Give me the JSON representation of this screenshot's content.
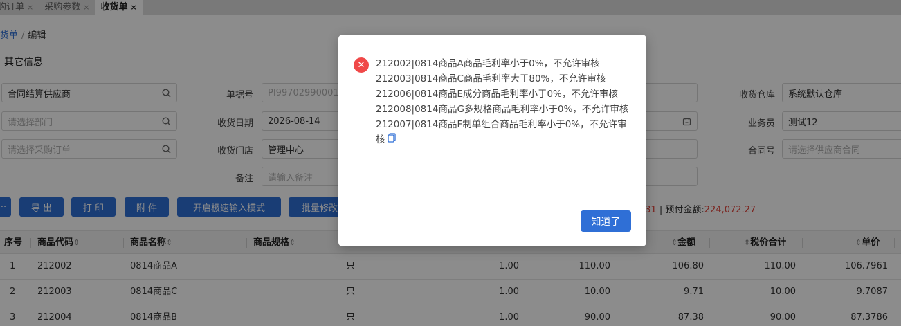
{
  "tabs": [
    {
      "label": "购订单",
      "close": "×"
    },
    {
      "label": "采购参数",
      "close": "×"
    },
    {
      "label": "收货单",
      "close": "×"
    }
  ],
  "breadcrumb": {
    "parent": "货单",
    "sep": "/",
    "current": "编辑"
  },
  "section_title": "其它信息",
  "form": {
    "supplier": {
      "value": "合同结算供应商"
    },
    "department": {
      "placeholder": "请选择部门"
    },
    "purchase_order": {
      "placeholder": "请选择采购订单"
    },
    "doc_no": {
      "label": "单据号",
      "value": "PI99702990001"
    },
    "receive_date": {
      "label": "收货日期",
      "value": "2026-08-14"
    },
    "receive_store": {
      "label": "收货门店",
      "value": "管理中心"
    },
    "remark": {
      "label": "备注",
      "placeholder": "请输入备注"
    },
    "warehouse": {
      "label": "收货仓库",
      "value": "系统默认仓库"
    },
    "salesman": {
      "label": "业务员",
      "value": "测试12"
    },
    "contract_no": {
      "label": "合同号",
      "placeholder": "请选择供应商合同"
    }
  },
  "toolbar": {
    "more": "···",
    "export": "导 出",
    "print": "打 印",
    "attach": "附 件",
    "fast_input": "开启极速输入模式",
    "batch_edit": "批量修改"
  },
  "summary": {
    "partial_value": ".31",
    "sep": "|",
    "prepay_label": "预付金额:",
    "prepay_value": "224,072.27"
  },
  "table": {
    "headers": {
      "seq": "序号",
      "code": "商品代码",
      "name": "商品名称",
      "spec": "商品规格",
      "amount": "金额",
      "total": "税价合计",
      "price": "单价"
    },
    "rows": [
      {
        "seq": "1",
        "code": "212002",
        "name": "0814商品A",
        "unit": "只",
        "qty": "1.00",
        "taxed": "110.00",
        "amount": "106.80",
        "total": "110.00",
        "price": "106.7961"
      },
      {
        "seq": "2",
        "code": "212003",
        "name": "0814商品C",
        "unit": "只",
        "qty": "1.00",
        "taxed": "10.00",
        "amount": "9.71",
        "total": "10.00",
        "price": "9.7087"
      },
      {
        "seq": "3",
        "code": "212004",
        "name": "0814商品B",
        "unit": "只",
        "qty": "1.00",
        "taxed": "90.00",
        "amount": "87.38",
        "total": "90.00",
        "price": "87.3786"
      }
    ]
  },
  "dialog": {
    "messages": [
      "212002|0814商品A商品毛利率小于0%，不允许审核",
      "212003|0814商品C商品毛利率大于80%，不允许审核",
      "212006|0814商品E成分商品毛利率小于0%，不允许审核",
      "212008|0814商品G多规格商品毛利率小于0%，不允许审核",
      "212007|0814商品F制单组合商品毛利率小于0%，不允许审核"
    ],
    "ok_label": "知道了"
  },
  "colors": {
    "primary": "#2f6fd6",
    "error": "#f04848",
    "amount_red": "#e0443b"
  }
}
